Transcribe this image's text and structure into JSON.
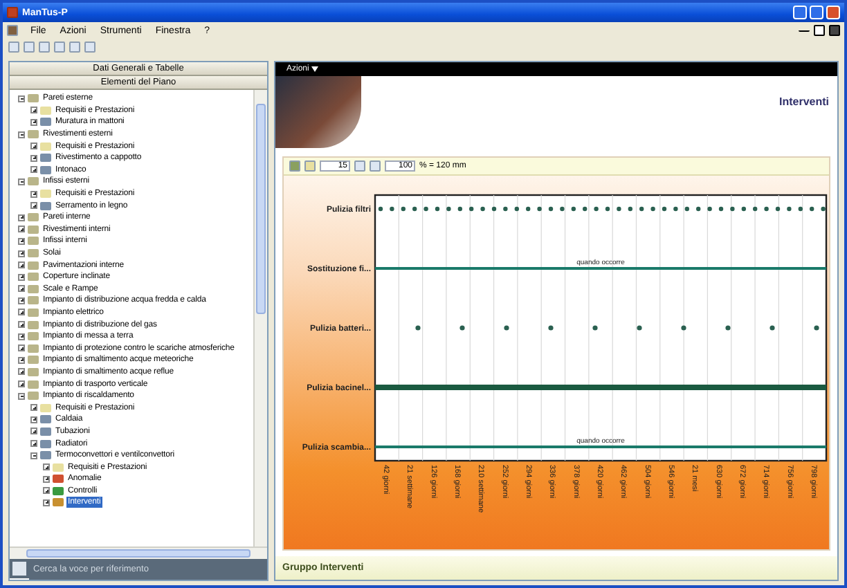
{
  "window": {
    "title": "ManTus-P"
  },
  "menu": [
    "File",
    "Azioni",
    "Strumenti",
    "Finestra",
    "?"
  ],
  "left_panel": {
    "headers": [
      "Dati Generali e Tabelle",
      "Elementi del Piano"
    ],
    "tree": [
      {
        "label": "Pareti esterne",
        "kind": "group",
        "expanded": true,
        "selected": false,
        "children": [
          {
            "label": "Requisiti e Prestazioni",
            "kind": "requirements",
            "expanded": false,
            "selected": false
          },
          {
            "label": "Muratura in mattoni",
            "kind": "component",
            "expanded": false,
            "selected": false
          }
        ]
      },
      {
        "label": "Rivestimenti esterni",
        "kind": "group",
        "expanded": true,
        "selected": false,
        "children": [
          {
            "label": "Requisiti e Prestazioni",
            "kind": "requirements",
            "expanded": false,
            "selected": false
          },
          {
            "label": "Rivestimento a cappotto",
            "kind": "component",
            "expanded": false,
            "selected": false
          },
          {
            "label": "Intonaco",
            "kind": "component",
            "expanded": false,
            "selected": false
          }
        ]
      },
      {
        "label": "Infissi esterni",
        "kind": "group",
        "expanded": true,
        "selected": false,
        "children": [
          {
            "label": "Requisiti e Prestazioni",
            "kind": "requirements",
            "expanded": false,
            "selected": false
          },
          {
            "label": "Serramento in legno",
            "kind": "component",
            "expanded": false,
            "selected": false
          }
        ]
      },
      {
        "label": "Pareti interne",
        "kind": "group",
        "expanded": false,
        "selected": false
      },
      {
        "label": "Rivestimenti interni",
        "kind": "group",
        "expanded": false,
        "selected": false
      },
      {
        "label": "Infissi interni",
        "kind": "group",
        "expanded": false,
        "selected": false
      },
      {
        "label": "Solai",
        "kind": "group",
        "expanded": false,
        "selected": false
      },
      {
        "label": "Pavimentazioni interne",
        "kind": "group",
        "expanded": false,
        "selected": false
      },
      {
        "label": "Coperture inclinate",
        "kind": "group",
        "expanded": false,
        "selected": false
      },
      {
        "label": "Scale e Rampe",
        "kind": "group",
        "expanded": false,
        "selected": false
      },
      {
        "label": "Impianto di distribuzione acqua fredda e calda",
        "kind": "group",
        "expanded": false,
        "selected": false
      },
      {
        "label": "Impianto elettrico",
        "kind": "group",
        "expanded": false,
        "selected": false
      },
      {
        "label": "Impianto di distribuzione del gas",
        "kind": "group",
        "expanded": false,
        "selected": false
      },
      {
        "label": "Impianto di messa a terra",
        "kind": "group",
        "expanded": false,
        "selected": false
      },
      {
        "label": "Impianto di protezione contro le scariche atmosferiche",
        "kind": "group",
        "expanded": false,
        "selected": false
      },
      {
        "label": "Impianto di smaltimento acque meteoriche",
        "kind": "group",
        "expanded": false,
        "selected": false
      },
      {
        "label": "Impianto di smaltimento acque reflue",
        "kind": "group",
        "expanded": false,
        "selected": false
      },
      {
        "label": "Impianto di trasporto verticale",
        "kind": "group",
        "expanded": false,
        "selected": false
      },
      {
        "label": "Impianto di riscaldamento",
        "kind": "group",
        "expanded": true,
        "selected": false,
        "children": [
          {
            "label": "Requisiti e Prestazioni",
            "kind": "requirements",
            "expanded": false,
            "selected": false
          },
          {
            "label": "Caldaia",
            "kind": "component",
            "expanded": false,
            "selected": false
          },
          {
            "label": "Tubazioni",
            "kind": "component",
            "expanded": false,
            "selected": false
          },
          {
            "label": "Radiatori",
            "kind": "component",
            "expanded": false,
            "selected": false
          },
          {
            "label": "Termoconvettori e ventilconvettori",
            "kind": "component",
            "expanded": true,
            "selected": false,
            "children": [
              {
                "label": "Requisiti e Prestazioni",
                "kind": "requirements",
                "expanded": false,
                "selected": false
              },
              {
                "label": "Anomalie",
                "kind": "anomalies",
                "expanded": false,
                "selected": false
              },
              {
                "label": "Controlli",
                "kind": "controls",
                "expanded": false,
                "selected": false
              },
              {
                "label": "Interventi",
                "kind": "interventions",
                "expanded": false,
                "selected": true
              }
            ]
          }
        ]
      }
    ],
    "search_placeholder": "Cerca la voce per riferimento"
  },
  "actions_menu": "Azioni",
  "page_title": "Interventi",
  "chart_toolbar": {
    "zoom_value": "15",
    "scale_value": "100",
    "scale_note": "% = 120 mm"
  },
  "schedule": {
    "rows": [
      {
        "label": "Pulizia filtri",
        "kind": "dense"
      },
      {
        "label": "Sostituzione fi...",
        "kind": "line",
        "note": "quando occorre"
      },
      {
        "label": "Pulizia batteri...",
        "kind": "sparse"
      },
      {
        "label": "Pulizia bacinel...",
        "kind": "thick"
      },
      {
        "label": "Pulizia scambia...",
        "kind": "line",
        "note": "quando occorre"
      }
    ],
    "x_labels": [
      "42 giorni",
      "21 settimane",
      "126 giorni",
      "168 giorni",
      "210 settimane",
      "252 giorni",
      "294 giorni",
      "336 giorni",
      "378 giorni",
      "420 giorni",
      "462 giorni",
      "504 giorni",
      "546 giorni",
      "21 mesi",
      "630 giorni",
      "672 giorni",
      "714 giorni",
      "756 giorni",
      "798 giorni"
    ]
  },
  "status_bar": "Gruppo Interventi"
}
